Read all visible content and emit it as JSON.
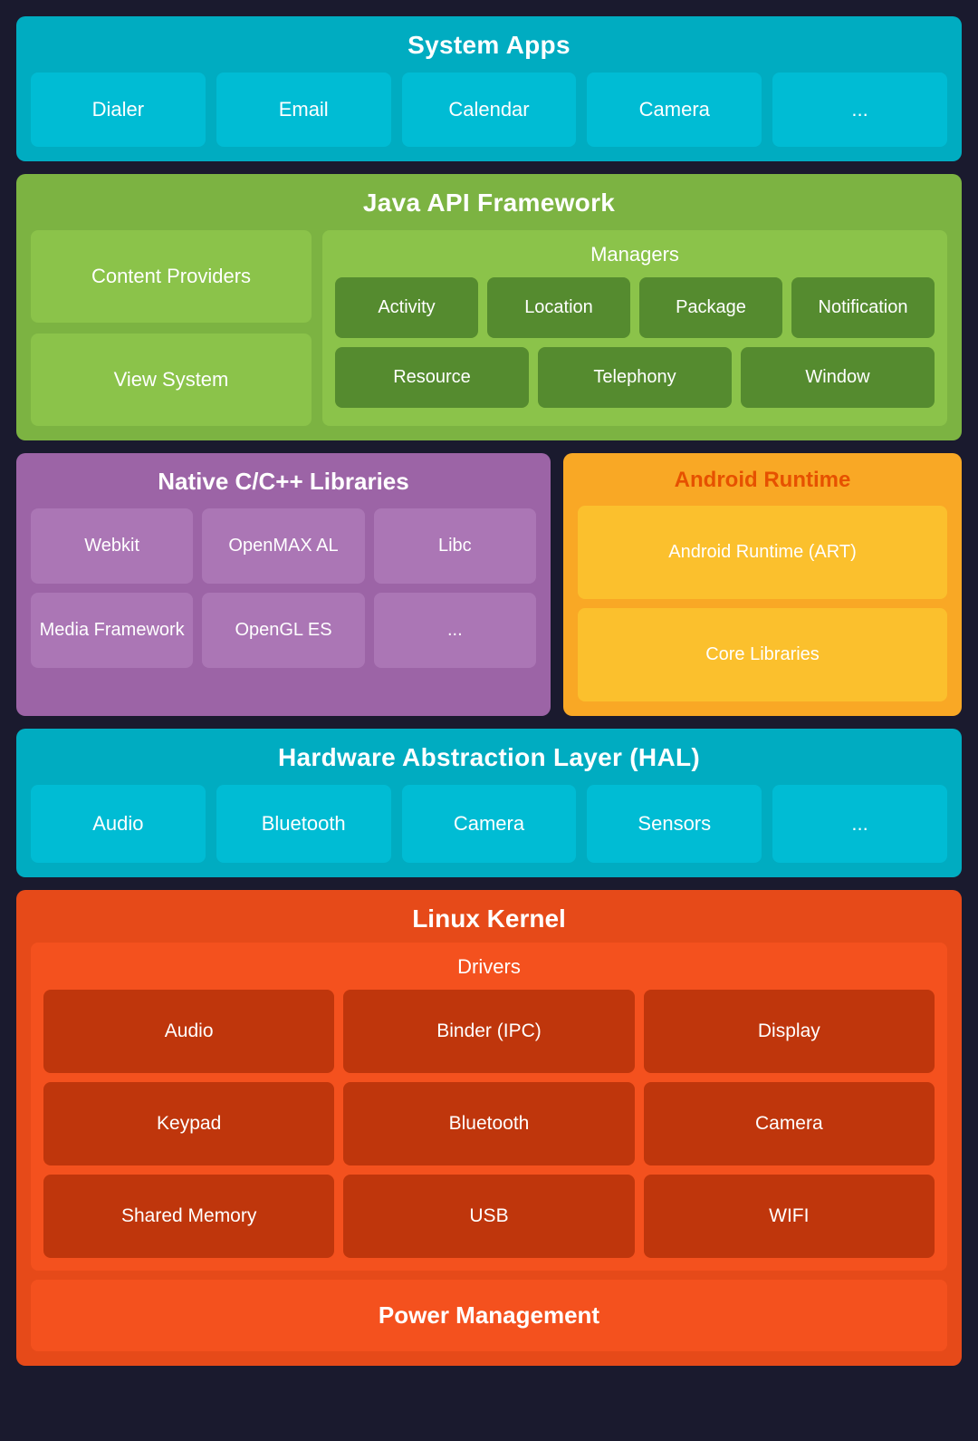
{
  "system_apps": {
    "title": "System Apps",
    "apps": [
      "Dialer",
      "Email",
      "Calendar",
      "Camera",
      "..."
    ]
  },
  "java_framework": {
    "title": "Java API Framework",
    "left_boxes": [
      "Content Providers",
      "View System"
    ],
    "managers": {
      "title": "Managers",
      "row1": [
        "Activity",
        "Location",
        "Package",
        "Notification"
      ],
      "row2": [
        "Resource",
        "Telephony",
        "Window"
      ]
    }
  },
  "native_libs": {
    "title": "Native C/C++ Libraries",
    "row1": [
      "Webkit",
      "OpenMAX AL",
      "Libc"
    ],
    "row2": [
      "Media Framework",
      "OpenGL ES",
      "..."
    ]
  },
  "android_runtime": {
    "title": "Android Runtime",
    "items": [
      "Android Runtime (ART)",
      "Core Libraries"
    ]
  },
  "hal": {
    "title": "Hardware Abstraction Layer (HAL)",
    "items": [
      "Audio",
      "Bluetooth",
      "Camera",
      "Sensors",
      "..."
    ]
  },
  "linux_kernel": {
    "title": "Linux Kernel",
    "drivers": {
      "title": "Drivers",
      "row1": [
        "Audio",
        "Binder (IPC)",
        "Display"
      ],
      "row2": [
        "Keypad",
        "Bluetooth",
        "Camera"
      ],
      "row3": [
        "Shared Memory",
        "USB",
        "WIFI"
      ]
    },
    "power_management": "Power Management"
  }
}
